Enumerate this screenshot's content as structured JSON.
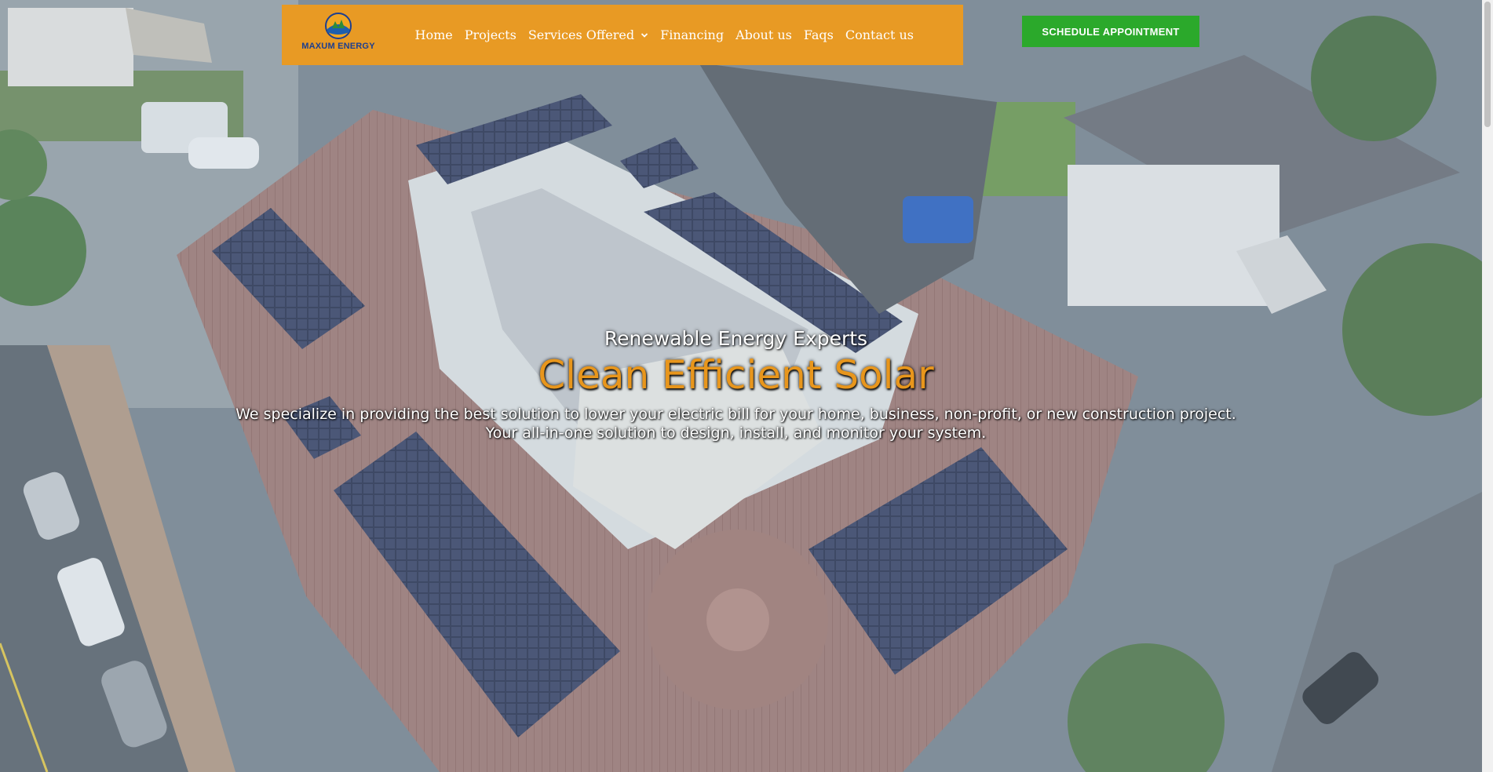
{
  "brand": {
    "name": "MAXUM ENERGY",
    "logo_icon": "sun-leaf-icon"
  },
  "nav": {
    "items": [
      {
        "label": "Home"
      },
      {
        "label": "Projects"
      },
      {
        "label": "Services Offered",
        "has_dropdown": true
      },
      {
        "label": "Financing"
      },
      {
        "label": "About us"
      },
      {
        "label": "Faqs"
      },
      {
        "label": "Contact us"
      }
    ]
  },
  "cta": {
    "label": "SCHEDULE APPOINTMENT"
  },
  "hero": {
    "eyebrow": "Renewable Energy Experts",
    "headline": "Clean Efficient Solar",
    "subline_1": "We specialize in providing the best solution to lower your electric bill for your home, business, non-profit, or new construction project.",
    "subline_2": "Your all-in-one solution to design, install, and monitor your system."
  },
  "colors": {
    "nav_bg": "#e89a24",
    "cta_bg": "#2ba92b",
    "headline": "#e8961c",
    "logo_text": "#1d3f8f"
  }
}
